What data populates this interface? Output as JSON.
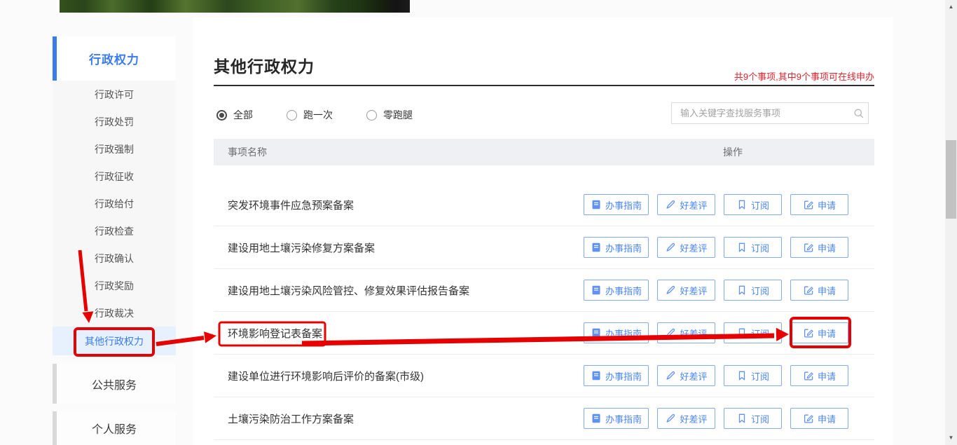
{
  "banner": {
    "description": "green-vegetation-photo-strip"
  },
  "sidebar": {
    "section_power": {
      "title": "行政权力",
      "items": [
        {
          "label": "行政许可"
        },
        {
          "label": "行政处罚"
        },
        {
          "label": "行政强制"
        },
        {
          "label": "行政征收"
        },
        {
          "label": "行政给付"
        },
        {
          "label": "行政检查"
        },
        {
          "label": "行政确认"
        },
        {
          "label": "行政奖励"
        },
        {
          "label": "行政裁决"
        },
        {
          "label": "其他行政权力",
          "active": true
        }
      ]
    },
    "section_public": {
      "title": "公共服务"
    },
    "section_personal": {
      "title": "个人服务"
    }
  },
  "main": {
    "title": "其他行政权力",
    "summary": "共9个事项,其中9个事项可在线申办",
    "filters": [
      {
        "label": "全部",
        "selected": true
      },
      {
        "label": "跑一次",
        "selected": false
      },
      {
        "label": "零跑腿",
        "selected": false
      }
    ],
    "search": {
      "placeholder": "输入关键字查找服务事项",
      "icon": "magnifier-icon"
    },
    "table": {
      "header_name": "事项名称",
      "header_action": "操作",
      "actions": {
        "guide": "办事指南",
        "review": "好差评",
        "subscribe": "订阅",
        "apply": "申请"
      },
      "rows": [
        {
          "name": "突发环境事件应急预案备案"
        },
        {
          "name": "建设用地土壤污染修复方案备案"
        },
        {
          "name": "建设用地土壤污染风险管控、修复效果评估报告备案"
        },
        {
          "name": "环境影响登记表备案",
          "annotated": true
        },
        {
          "name": "建设单位进行环境影响后评价的备案(市级)"
        },
        {
          "name": "土壤污染防治工作方案备案"
        }
      ]
    }
  },
  "scrollbar": {
    "up": "▲",
    "down": "▼"
  },
  "colors": {
    "accent_blue": "#3a7bf0",
    "button_blue": "#4a86ef",
    "annotation_red": "#e60000",
    "summary_red": "#d9252e",
    "active_item_bg": "#e7f1fd"
  }
}
